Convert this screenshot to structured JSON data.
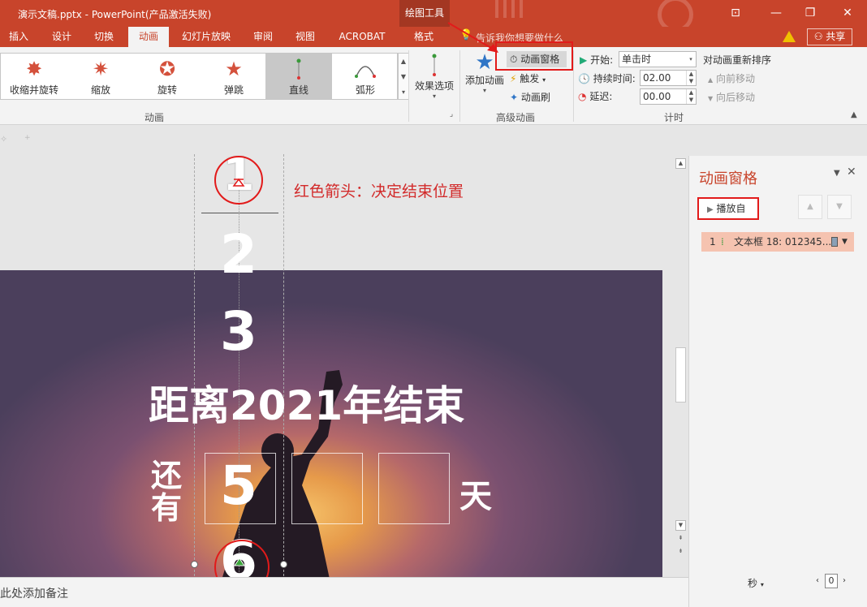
{
  "titlebar": {
    "title": "演示文稿.pptx - PowerPoint(产品激活失败)",
    "context_tab": "绘图工具",
    "tell_me": "告诉我你想要做什么"
  },
  "tabs": [
    "插入",
    "设计",
    "切换",
    "动画",
    "幻灯片放映",
    "审阅",
    "视图",
    "ACROBAT",
    "格式"
  ],
  "active_tab": "动画",
  "share_label": "共享",
  "gallery": {
    "items": [
      {
        "label": "收缩并旋转",
        "icon": "shrink-spin-icon"
      },
      {
        "label": "缩放",
        "icon": "zoom-icon"
      },
      {
        "label": "旋转",
        "icon": "spin-icon"
      },
      {
        "label": "弹跳",
        "icon": "bounce-icon"
      },
      {
        "label": "直线",
        "icon": "line-path-icon",
        "selected": true
      },
      {
        "label": "弧形",
        "icon": "arc-path-icon"
      }
    ],
    "group_label": "动画"
  },
  "effect_options_label": "效果选项",
  "advanced": {
    "add_animation": "添加动画",
    "animation_pane": "动画窗格",
    "trigger": "触发",
    "painter": "动画刷",
    "group_label": "高级动画"
  },
  "timing": {
    "start_label": "开始:",
    "start_value": "单击时",
    "duration_label": "持续时间:",
    "duration_value": "02.00",
    "delay_label": "延迟:",
    "delay_value": "00.00",
    "group_label": "计时",
    "reorder_label": "对动画重新排序",
    "move_earlier": "向前移动",
    "move_later": "向后移动"
  },
  "slide": {
    "annotation": "红色箭头：决定结束位置",
    "numbers": [
      "1",
      "2",
      "3",
      "5",
      "6"
    ],
    "headline": "距离2021年结束",
    "still": "还",
    "have": "有",
    "day": "天"
  },
  "notes_placeholder": "单击此处添加备注",
  "pane": {
    "title": "动画窗格",
    "play_from": "播放自",
    "item_index": "1",
    "item_label": "文本框 18: 012345...",
    "seconds_label": "秒",
    "zoom_value": "0"
  },
  "colors": {
    "brand": "#c8442b",
    "highlight_red": "#e21a1a",
    "pane_item_bg": "#f5c3b0"
  }
}
